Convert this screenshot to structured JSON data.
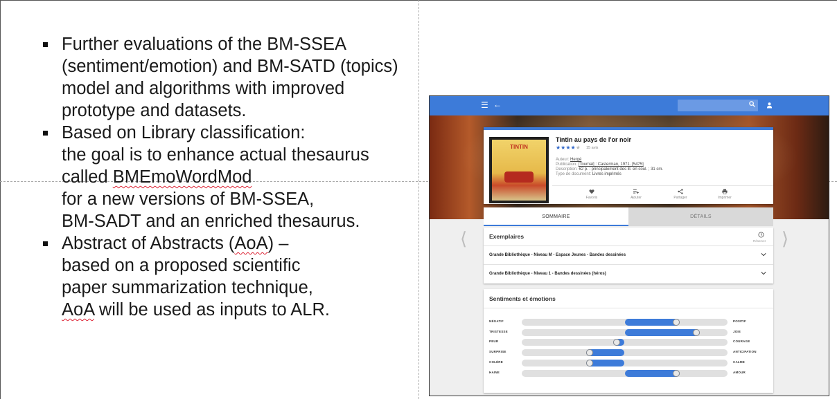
{
  "bullets": [
    {
      "lines": [
        [
          {
            "t": "Further evaluations of the BM-SSEA"
          }
        ],
        [
          {
            "t": "(sentiment/emotion) and BM-SATD (topics)"
          }
        ],
        [
          {
            "t": "model and algorithms with improved"
          }
        ],
        [
          {
            "t": "prototype and datasets."
          }
        ]
      ]
    },
    {
      "lines": [
        [
          {
            "t": "Based on Library classification:"
          }
        ],
        [
          {
            "t": "the goal is to enhance actual thesaurus"
          }
        ],
        [
          {
            "t": "called "
          },
          {
            "t": "BMEmoWordMod",
            "wavy": true
          }
        ],
        [
          {
            "t": "for a new versions of BM-SSEA,"
          }
        ],
        [
          {
            "t": "BM-SADT and an enriched thesaurus."
          }
        ]
      ]
    },
    {
      "lines": [
        [
          {
            "t": "Abstract of Abstracts ("
          },
          {
            "t": "AoA",
            "wavy": true
          },
          {
            "t": ") –"
          }
        ],
        [
          {
            "t": "based on a proposed scientific"
          }
        ],
        [
          {
            "t": "paper summarization technique,"
          }
        ],
        [
          {
            "t": "AoA",
            "wavy": true
          },
          {
            "t": " will be used as inputs to ALR."
          }
        ]
      ]
    }
  ],
  "app": {
    "colors": {
      "primary": "#3d7bd9",
      "track": "#e0e0e0"
    },
    "icons": [
      "menu-icon",
      "back-arrow-icon",
      "search-icon",
      "user-icon",
      "heart-icon",
      "playlist-add-icon",
      "share-icon",
      "print-icon",
      "clock-icon",
      "chevron-down-icon",
      "chevron-left-icon",
      "chevron-right-icon",
      "smiley-icon"
    ],
    "book": {
      "title": "Tintin au pays de l'or noir",
      "cover_title": "TINTIN",
      "rating": 4,
      "rating_count": "15 avis",
      "author_label": "Auteur: ",
      "author": "Hergé",
      "publication_label": "Publication: ",
      "publication": "[Tournai] : Casterman, 1971. [5475]",
      "description_label": "Description: ",
      "description": "62 p. : principalement des ill. en coul. ; 31 cm.",
      "doctype_label": "Type de document: ",
      "doctype": "Livres imprimés",
      "actions": [
        "Favoris",
        "Ajouter",
        "Partager",
        "Imprimer"
      ]
    },
    "tabs": [
      "SOMMAIRE",
      "DÉTAILS"
    ],
    "exemplaires": {
      "title": "Exemplaires",
      "reserve_label": "Réserver",
      "rows": [
        "Grande Bibliothèque - Niveau M - Espace Jeunes - Bandes dessinées",
        "Grande Bibliothèque - Niveau 1 - Bandes dessinées (héros)"
      ]
    },
    "sentiments": {
      "title": "Sentiments et émotions",
      "rows": [
        {
          "left": "NÉGATIF",
          "right": "POSITIF",
          "value": 0.25
        },
        {
          "left": "TRISTESSE",
          "right": "JOIE",
          "value": 0.35
        },
        {
          "left": "PEUR",
          "right": "COURAGE",
          "value": -0.04
        },
        {
          "left": "SURPRISE",
          "right": "ANTICIPATION",
          "value": -0.17
        },
        {
          "left": "COLÈRE",
          "right": "CALME",
          "value": -0.17
        },
        {
          "left": "HAINE",
          "right": "AMOUR",
          "value": 0.25
        }
      ]
    }
  }
}
